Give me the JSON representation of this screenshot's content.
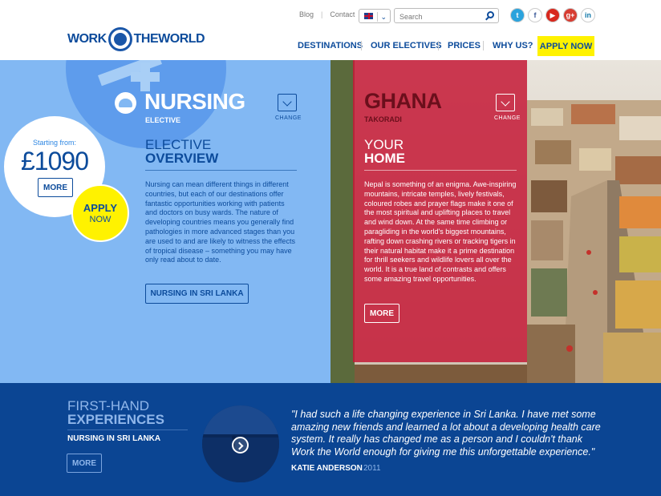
{
  "brand": {
    "logo_left": "WORK",
    "logo_right": "THEWORLD"
  },
  "header": {
    "toplinks": [
      "Blog",
      "Contact"
    ],
    "search_placeholder": "Search",
    "social": [
      "twitter-icon",
      "facebook-icon",
      "youtube-icon",
      "google-plus-icon",
      "linkedin-icon"
    ],
    "social_glyphs": [
      "t",
      "f",
      "▶",
      "g+",
      "in"
    ],
    "nav": [
      "DESTINATIONS",
      "OUR ELECTIVES",
      "PRICES",
      "WHY US?"
    ],
    "apply": "APPLY NOW"
  },
  "elective": {
    "title": "NURSING",
    "subtitle": "ELECTIVE",
    "change": "CHANGE",
    "starting_from": "Starting from:",
    "price": "£1090",
    "more": "MORE",
    "apply_line1": "APPLY",
    "apply_line2": "NOW",
    "overview_line1": "ELECTIVE",
    "overview_line2": "OVERVIEW",
    "overview_text": "Nursing can mean different things in different countries, but each of our destinations offer fantastic opportunities working with patients and doctors on busy wards. The nature of developing countries means you generally find pathologies in more advanced stages than you are used to and are likely to witness the effects of tropical disease – something you may have only read about to date.",
    "location_button": "NURSING IN SRI LANKA"
  },
  "destination": {
    "title": "GHANA",
    "subtitle": "TAKORADI",
    "change": "CHANGE",
    "home_line1": "YOUR",
    "home_line2": "HOME",
    "home_text": "Nepal is something of an enigma. Awe-inspiring mountains, intricate temples, lively festivals, coloured robes and prayer flags make it one of the most spiritual and uplifting places to travel and wind down. At the same time climbing or paragliding in the world's biggest mountains, rafting down crashing rivers or tracking tigers in their natural habitat make it a prime destination for thrill seekers and wildlife lovers all over the world. It is a true land of contrasts and offers some amazing travel opportunities.",
    "more": "MORE"
  },
  "experiences": {
    "line1": "FIRST-HAND",
    "line2": "EXPERIENCES",
    "location": "NURSING IN SRI LANKA",
    "more": "MORE",
    "quote": "\"I had such a life changing experience in Sri Lanka. I have met some amazing new friends and learned a lot about a developing health care system. It really has changed me as a person and I couldn't thank Work the World enough for giving me this unforgettable experience.\"",
    "author": "KATIE ANDERSON",
    "year": "2011"
  },
  "colors": {
    "brand_blue": "#0c4b9b",
    "light_blue": "#82b8f3",
    "ghana_red": "#c41936",
    "apply_yellow": "#fff200",
    "band_blue": "#0b4593"
  }
}
